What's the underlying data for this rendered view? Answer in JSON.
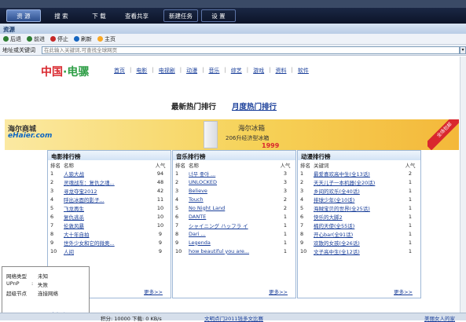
{
  "tabs": [
    "资 源",
    "搜 索",
    "下 载",
    "查看共享",
    "新建任务",
    "设 置"
  ],
  "section_title": "资源",
  "nav_buttons": [
    {
      "icon": "back-icon",
      "label": "后退",
      "color": "#2e7d32"
    },
    {
      "icon": "forward-icon",
      "label": "前进",
      "color": "#2e7d32"
    },
    {
      "icon": "stop-icon",
      "label": "停止",
      "color": "#c62828"
    },
    {
      "icon": "refresh-icon",
      "label": "刷新",
      "color": "#1565c0"
    },
    {
      "icon": "home-icon",
      "label": "主页",
      "color": "#f9a825"
    }
  ],
  "address": {
    "label": "地址或关键词",
    "placeholder": "在此输入关键词,可查找全球网页"
  },
  "portal": {
    "logo_a": "中国",
    "logo_b": "·电骡",
    "menu": [
      "首页",
      "电影",
      "电视剧",
      "动漫",
      "音乐",
      "综艺",
      "游戏",
      "资料",
      "软件"
    ]
  },
  "rank_tabs": {
    "latest": "最新热门排行",
    "monthly": "月度热门排行"
  },
  "banner": {
    "brand_line1": "海尔商城",
    "brand_line2": "eHaier.com",
    "product": "海尔冰箱",
    "desc": "206升经济型冰箱",
    "price": "1999",
    "corner": "全场包邮"
  },
  "panels": [
    {
      "title": "电影排行榜",
      "headers": [
        "排名",
        "名称",
        "人气"
      ],
      "rows": [
        [
          "1",
          "人狼大战",
          "94"
        ],
        [
          "2",
          "灵魂战车：复仇之魂...",
          "48"
        ],
        [
          "3",
          "寻龙夺宝2012",
          "42"
        ],
        [
          "4",
          "呼出冰面的影子...",
          "11"
        ],
        [
          "5",
          "飞龙再生",
          "10"
        ],
        [
          "6",
          "复仇逃杀",
          "10"
        ],
        [
          "7",
          "伦敦风暴",
          "10"
        ],
        [
          "8",
          "大十年自拍",
          "9"
        ],
        [
          "9",
          "世外少女和它的微奥...",
          "9"
        ],
        [
          "10",
          "人间",
          "9"
        ]
      ],
      "more": "更多>>"
    },
    {
      "title": "音乐排行榜",
      "headers": [
        "排名",
        "名称",
        "人气"
      ],
      "rows": [
        [
          "1",
          "너무 좋아 ...",
          "3"
        ],
        [
          "2",
          "UNLOCKED",
          "3"
        ],
        [
          "3",
          "Believe",
          "3"
        ],
        [
          "4",
          "Touch",
          "2"
        ],
        [
          "5",
          "No Night Land",
          "2"
        ],
        [
          "6",
          "DANTE",
          "1"
        ],
        [
          "7",
          "シャイニング ハッフラ イ",
          "1"
        ],
        [
          "8",
          "Dari ...",
          "1"
        ],
        [
          "9",
          "Legenda",
          "1"
        ],
        [
          "10",
          "how beautiful you are...",
          "1"
        ]
      ],
      "more": "更多>>"
    },
    {
      "title": "动漫排行榜",
      "headers": [
        "排名",
        "关键词",
        "人气"
      ],
      "rows": [
        [
          "1",
          "最爱喜欢高中生(全13话)",
          "2"
        ],
        [
          "2",
          "天天儿子一本机器(全20话)",
          "1"
        ],
        [
          "3",
          "乡间的欢乐(全40话)",
          "1"
        ],
        [
          "4",
          "排球少年(全10话)",
          "1"
        ],
        [
          "5",
          "海贼宝贝的世界(全25话)",
          "1"
        ],
        [
          "6",
          "快乐的大脚2",
          "1"
        ],
        [
          "7",
          "楠的天使(全55话)",
          "1"
        ],
        [
          "8",
          "开心bar(全91话)",
          "1"
        ],
        [
          "9",
          "欢散的女孩(全26话)",
          "1"
        ],
        [
          "10",
          "文子高中生(全12话)",
          "1"
        ]
      ],
      "more": "更多>>"
    }
  ],
  "popup": {
    "rows": [
      [
        "网络类型",
        "未知"
      ],
      [
        "UPnP",
        "失败"
      ],
      [
        "超级节点",
        "连接网络"
      ]
    ],
    "help": "更多帮助"
  },
  "status": {
    "speed": "积分: 10000  下载: 0 KB/s",
    "link": "文明点门2011钱多文比赛",
    "right": "美丽女人的家"
  }
}
